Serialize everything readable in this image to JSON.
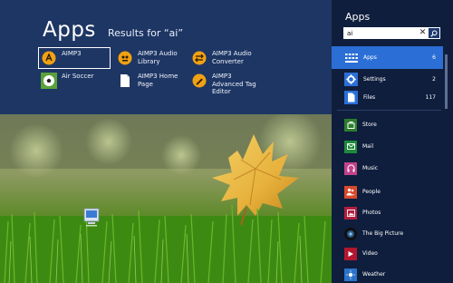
{
  "results": {
    "title": "Apps",
    "subtitle": "Results for “ai”",
    "items": [
      {
        "label": "AIMP3",
        "icon": "aimp-icon",
        "selected": true
      },
      {
        "label": "AIMP3 Audio Library",
        "icon": "aimp-audio-library-icon"
      },
      {
        "label": "AIMP3 Audio Converter",
        "icon": "aimp-audio-converter-icon"
      },
      {
        "label": "Air Soccer",
        "icon": "soccer-ball-icon"
      },
      {
        "label": "AIMP3 Home Page",
        "icon": "document-icon"
      },
      {
        "label": "AIMP3 Advanced Tag Editor",
        "icon": "aimp-tag-editor-icon"
      }
    ]
  },
  "search": {
    "title": "Apps",
    "query": "ai",
    "clear_glyph": "✕",
    "scopes": [
      {
        "label": "Apps",
        "count": "6",
        "icon": "apps-grid-icon",
        "active": true
      },
      {
        "label": "Settings",
        "count": "2",
        "icon": "settings-gear-icon"
      },
      {
        "label": "Files",
        "count": "117",
        "icon": "files-icon"
      }
    ],
    "apps": [
      {
        "label": "Store",
        "icon": "store-icon",
        "color": "#2d7d2d"
      },
      {
        "label": "Mail",
        "icon": "mail-icon",
        "color": "#1f8a3b"
      },
      {
        "label": "Music",
        "icon": "headphones-icon",
        "color": "#c2418a"
      },
      {
        "label": "People",
        "icon": "people-icon",
        "color": "#d9492b"
      },
      {
        "label": "Photos",
        "icon": "photos-icon",
        "color": "#b01e3f"
      },
      {
        "label": "The Big Picture",
        "icon": "big-picture-icon",
        "color": "#101010"
      },
      {
        "label": "Video",
        "icon": "video-icon",
        "color": "#b3162f"
      },
      {
        "label": "Weather",
        "icon": "weather-icon",
        "color": "#2b73c9"
      }
    ]
  },
  "colors": {
    "results_bg": "#1e3664",
    "charm_bg": "#0f1e3d",
    "active_scope": "#2b6fd6",
    "aimp_orange": "#f0a212"
  }
}
